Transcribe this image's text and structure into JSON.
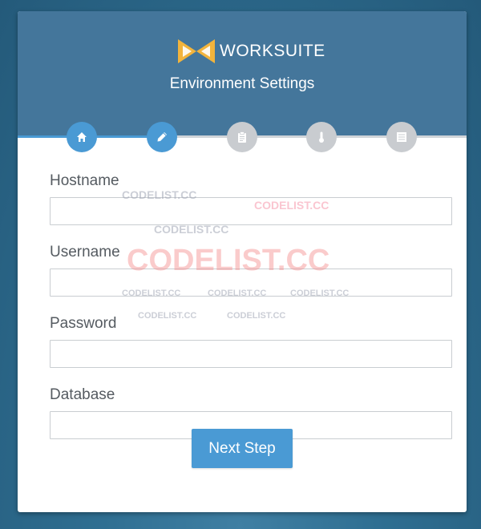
{
  "brand": {
    "name": "WORKSUITE",
    "logo_icon": "bowtie-logo-icon",
    "logo_color": "#f2b43c"
  },
  "header": {
    "subtitle": "Environment Settings",
    "background_color": "#44769b"
  },
  "stepper": {
    "steps": [
      {
        "icon": "home-icon",
        "state": "completed"
      },
      {
        "icon": "pencil-icon",
        "state": "active"
      },
      {
        "icon": "clipboard-icon",
        "state": "pending"
      },
      {
        "icon": "thermometer-icon",
        "state": "pending"
      },
      {
        "icon": "list-icon",
        "state": "pending"
      }
    ],
    "active_color": "#4a9ad4",
    "inactive_color": "#c9ccd0"
  },
  "form": {
    "fields": [
      {
        "label": "Hostname",
        "value": ""
      },
      {
        "label": "Username",
        "value": ""
      },
      {
        "label": "Password",
        "value": ""
      },
      {
        "label": "Database",
        "value": ""
      }
    ],
    "submit_label": "Next Step"
  },
  "watermark": {
    "text": "CODELIST.CC"
  }
}
